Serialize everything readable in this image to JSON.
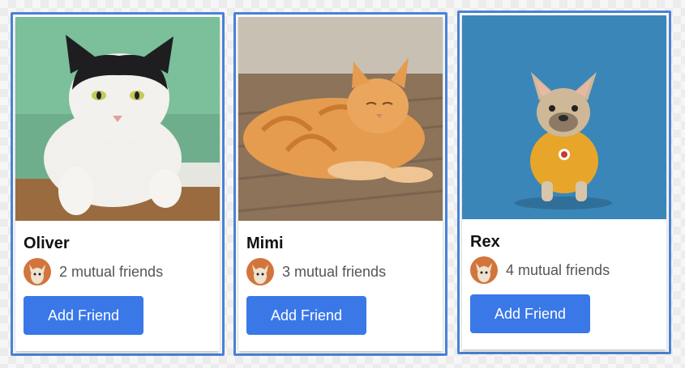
{
  "colors": {
    "frame_border": "#4a82d6",
    "button_bg": "#3a78e8",
    "button_text": "#ffffff",
    "mutual_text": "#555555"
  },
  "cards": [
    {
      "name": "Oliver",
      "mutual_friends": "2 mutual friends",
      "button_label": "Add Friend",
      "photo_icon": "cat-photo"
    },
    {
      "name": "Mimi",
      "mutual_friends": "3 mutual friends",
      "button_label": "Add Friend",
      "photo_icon": "cat-photo"
    },
    {
      "name": "Rex",
      "mutual_friends": "4 mutual friends",
      "button_label": "Add Friend",
      "photo_icon": "dog-photo"
    }
  ]
}
